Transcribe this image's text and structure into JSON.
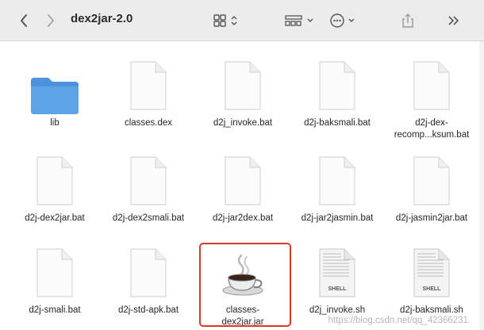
{
  "window": {
    "title": "dex2jar-2.0"
  },
  "toolbar": {
    "back_icon": "chevron-left-icon",
    "forward_icon": "chevron-right-icon",
    "view_icon": "grid-view-icon",
    "group_icon": "group-view-icon",
    "action_icon": "ellipsis-circle-icon",
    "share_icon": "share-icon",
    "more_icon": "double-chevron-right-icon"
  },
  "files": [
    {
      "name": "lib",
      "kind": "folder"
    },
    {
      "name": "classes.dex",
      "kind": "doc"
    },
    {
      "name": "d2j_invoke.bat",
      "kind": "doc"
    },
    {
      "name": "d2j-baksmali.bat",
      "kind": "doc"
    },
    {
      "name": "d2j-dex-\nrecomp...ksum.bat",
      "kind": "doc"
    },
    {
      "name": "d2j-dex2jar.bat",
      "kind": "doc"
    },
    {
      "name": "d2j-dex2smali.bat",
      "kind": "doc"
    },
    {
      "name": "d2j-jar2dex.bat",
      "kind": "doc"
    },
    {
      "name": "d2j-jar2jasmin.bat",
      "kind": "doc"
    },
    {
      "name": "d2j-jasmin2jar.bat",
      "kind": "doc"
    },
    {
      "name": "d2j-smali.bat",
      "kind": "doc"
    },
    {
      "name": "d2j-std-apk.bat",
      "kind": "doc"
    },
    {
      "name": "classes-\ndex2jar.jar",
      "kind": "jar",
      "selected": true
    },
    {
      "name": "d2j_invoke.sh",
      "kind": "shell",
      "badge": "SHELL"
    },
    {
      "name": "d2j-baksmali.sh",
      "kind": "shell",
      "badge": "SHELL"
    }
  ],
  "watermark": "https://blog.csdn.net/qq_42366231",
  "colors": {
    "folder": "#5ea3e8",
    "selection": "#d93a2b"
  }
}
